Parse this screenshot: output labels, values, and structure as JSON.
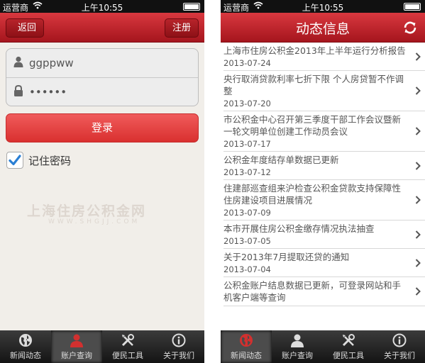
{
  "login_screen": {
    "status": {
      "carrier": "运营商",
      "time": "上午10:55"
    },
    "nav": {
      "back_label": "返回",
      "register_label": "注册"
    },
    "form": {
      "username_value": "ggppww",
      "password_value": "••••••"
    },
    "login_label": "登录",
    "remember_label": "记住密码",
    "watermark": {
      "text": "上海住房公积金网",
      "url": "WWW.SHGJJ.COM"
    },
    "tabs": [
      {
        "label": "新闻动态",
        "icon": "globe-icon"
      },
      {
        "label": "账户查询",
        "icon": "user-icon"
      },
      {
        "label": "便民工具",
        "icon": "tools-icon"
      },
      {
        "label": "关于我们",
        "icon": "info-icon"
      }
    ],
    "active_tab": 1
  },
  "news_screen": {
    "status": {
      "carrier": "运营商",
      "time": "上午10:55"
    },
    "nav": {
      "title": "动态信息"
    },
    "items": [
      {
        "title": "上海市住房公积金2013年上半年运行分析报告",
        "date": "2013-07-24"
      },
      {
        "title": "央行取消贷款利率七折下限 个人房贷暂不作调整",
        "date": "2013-07-20"
      },
      {
        "title": "市公积金中心召开第三季度干部工作会议暨新一轮文明单位创建工作动员会议",
        "date": "2013-07-17"
      },
      {
        "title": "公积金年度结存单数据已更新",
        "date": "2013-07-12"
      },
      {
        "title": "住建部巡查组来沪检查公积金贷款支持保障性住房建设项目进展情况",
        "date": "2013-07-09"
      },
      {
        "title": "本市开展住房公积金缴存情况执法抽查",
        "date": "2013-07-05"
      },
      {
        "title": "关于2013年7月提取还贷的通知",
        "date": "2013-07-04"
      },
      {
        "title": "公积金账户结息数据已更新，可登录网站和手机客户端等查询",
        "date": ""
      }
    ],
    "tabs": [
      {
        "label": "新闻动态",
        "icon": "globe-icon"
      },
      {
        "label": "账户查询",
        "icon": "user-icon"
      },
      {
        "label": "便民工具",
        "icon": "tools-icon"
      },
      {
        "label": "关于我们",
        "icon": "info-icon"
      }
    ],
    "active_tab": 0
  },
  "colors": {
    "brand_red": "#c1262d",
    "tabbar": "#1e1e1e",
    "login_button": "#e54545",
    "checkbox": "#2a7fd4"
  }
}
